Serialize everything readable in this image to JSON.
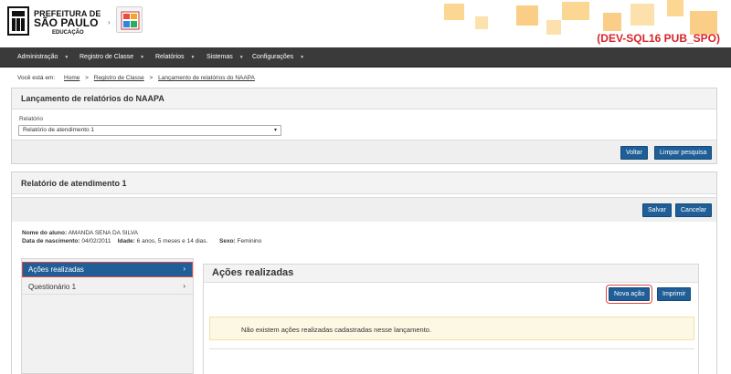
{
  "header": {
    "logo_line1": "PREFEITURA DE",
    "logo_line2": "SÃO PAULO",
    "logo_line3": "EDUCAÇÃO",
    "env_tag": "(DEV-SQL16 PUB_SPO)",
    "accent": "#f5a623"
  },
  "nav": {
    "items": [
      {
        "label": "Administração"
      },
      {
        "label": "Registro de Classe"
      },
      {
        "label": "Relatórios"
      },
      {
        "label": "Sistemas"
      },
      {
        "label": "Configurações"
      }
    ]
  },
  "breadcrumb": {
    "prefix": "Você está em:",
    "items": [
      "Home",
      "Registro de Classe",
      "Lançamento de relatórios do NAAPA"
    ]
  },
  "filter_panel": {
    "title": "Lançamento de relatórios do NAAPA",
    "field_label": "Relatório",
    "selected_value": "Relatório de atendimento 1",
    "btn_voltar": "Voltar",
    "btn_limpar": "Limpar pesquisa"
  },
  "report_panel": {
    "title": "Relatório de atendimento 1",
    "btn_salvar": "Salvar",
    "btn_cancelar": "Cancelar",
    "student_label": "Nome do aluno:",
    "student_name": "AMANDA SENA DA SILVA",
    "birth_label": "Data de nascimento:",
    "birth_value": "04/02/2011",
    "age_label": "Idade:",
    "age_value": "6 anos, 5 meses e 14 dias.",
    "sex_label": "Sexo:",
    "sex_value": "Feminino"
  },
  "sidemenu": {
    "items": [
      {
        "label": "Ações realizadas",
        "active": true
      },
      {
        "label": "Questionário 1",
        "active": false
      }
    ]
  },
  "content": {
    "title": "Ações realizadas",
    "btn_nova": "Nova ação",
    "btn_imprimir": "Imprimir",
    "alert_text": "Não existem ações realizadas cadastradas nesse lançamento."
  }
}
